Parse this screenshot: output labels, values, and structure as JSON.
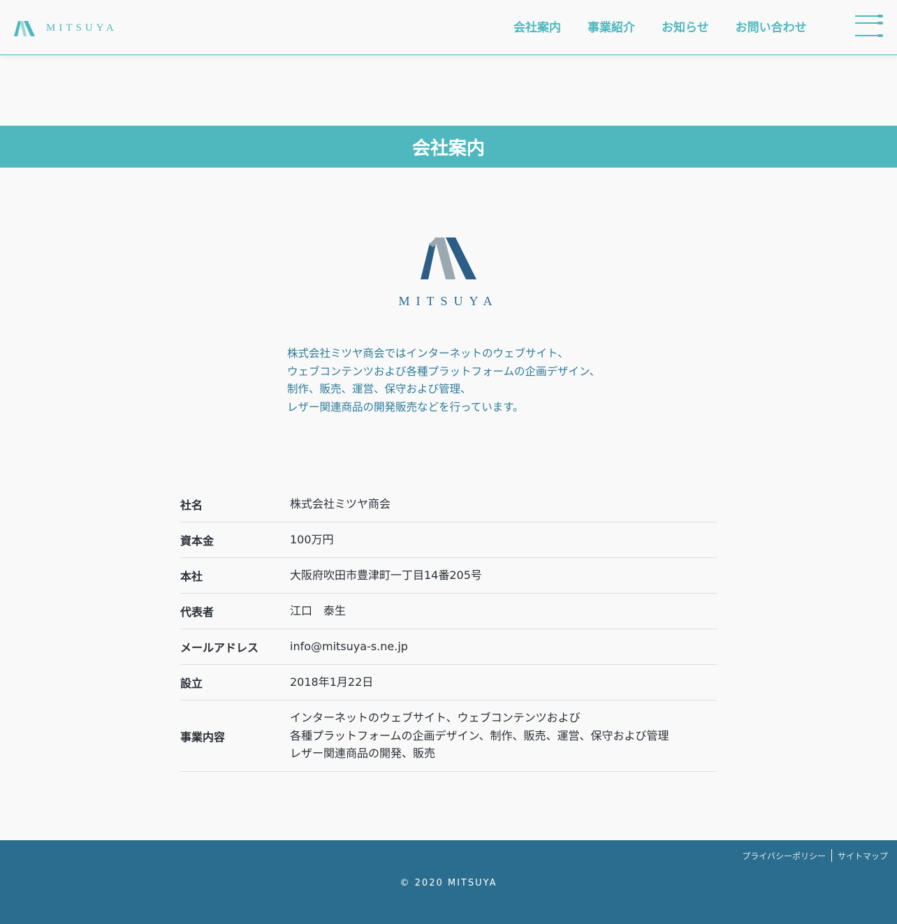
{
  "brand": {
    "name": "MITSUYA",
    "colors": {
      "accent": "#4fb8be",
      "navy": "#2b6a8e",
      "gray": "#9aa8b0",
      "footer": "#2b6d8e"
    }
  },
  "header": {
    "logo_text": "MITSUYA",
    "nav": [
      {
        "label": "会社案内"
      },
      {
        "label": "事業紹介"
      },
      {
        "label": "お知らせ"
      },
      {
        "label": "お問い合わせ"
      }
    ],
    "menu_icon": "hamburger-icon"
  },
  "page_title": "会社案内",
  "logo_big_text": "MITSUYA",
  "intro": [
    "株式会社ミツヤ商会ではインターネットのウェブサイト、",
    "ウェブコンテンツおよび各種プラットフォームの企画デザイン、",
    "制作、販売、運営、保守および管理、",
    "レザー関連商品の開発販売などを行っています。"
  ],
  "company_info": [
    {
      "label": "社名",
      "value": [
        "株式会社ミツヤ商会"
      ]
    },
    {
      "label": "資本金",
      "value": [
        "100万円"
      ]
    },
    {
      "label": "本社",
      "value": [
        "大阪府吹田市豊津町一丁目14番205号"
      ]
    },
    {
      "label": "代表者",
      "value": [
        "江口　泰生"
      ]
    },
    {
      "label": "メールアドレス",
      "value": [
        "info@mitsuya-s.ne.jp"
      ]
    },
    {
      "label": "設立",
      "value": [
        "2018年1月22日"
      ]
    },
    {
      "label": "事業内容",
      "value": [
        "インターネットのウェブサイト、ウェブコンテンツおよび",
        "各種プラットフォームの企画デザイン、制作、販売、運営、保守および管理",
        "レザー関連商品の開発、販売"
      ]
    }
  ],
  "footer": {
    "links": [
      "プライバシーポリシー",
      "サイトマップ"
    ],
    "copyright": "© 2020 MITSUYA"
  }
}
